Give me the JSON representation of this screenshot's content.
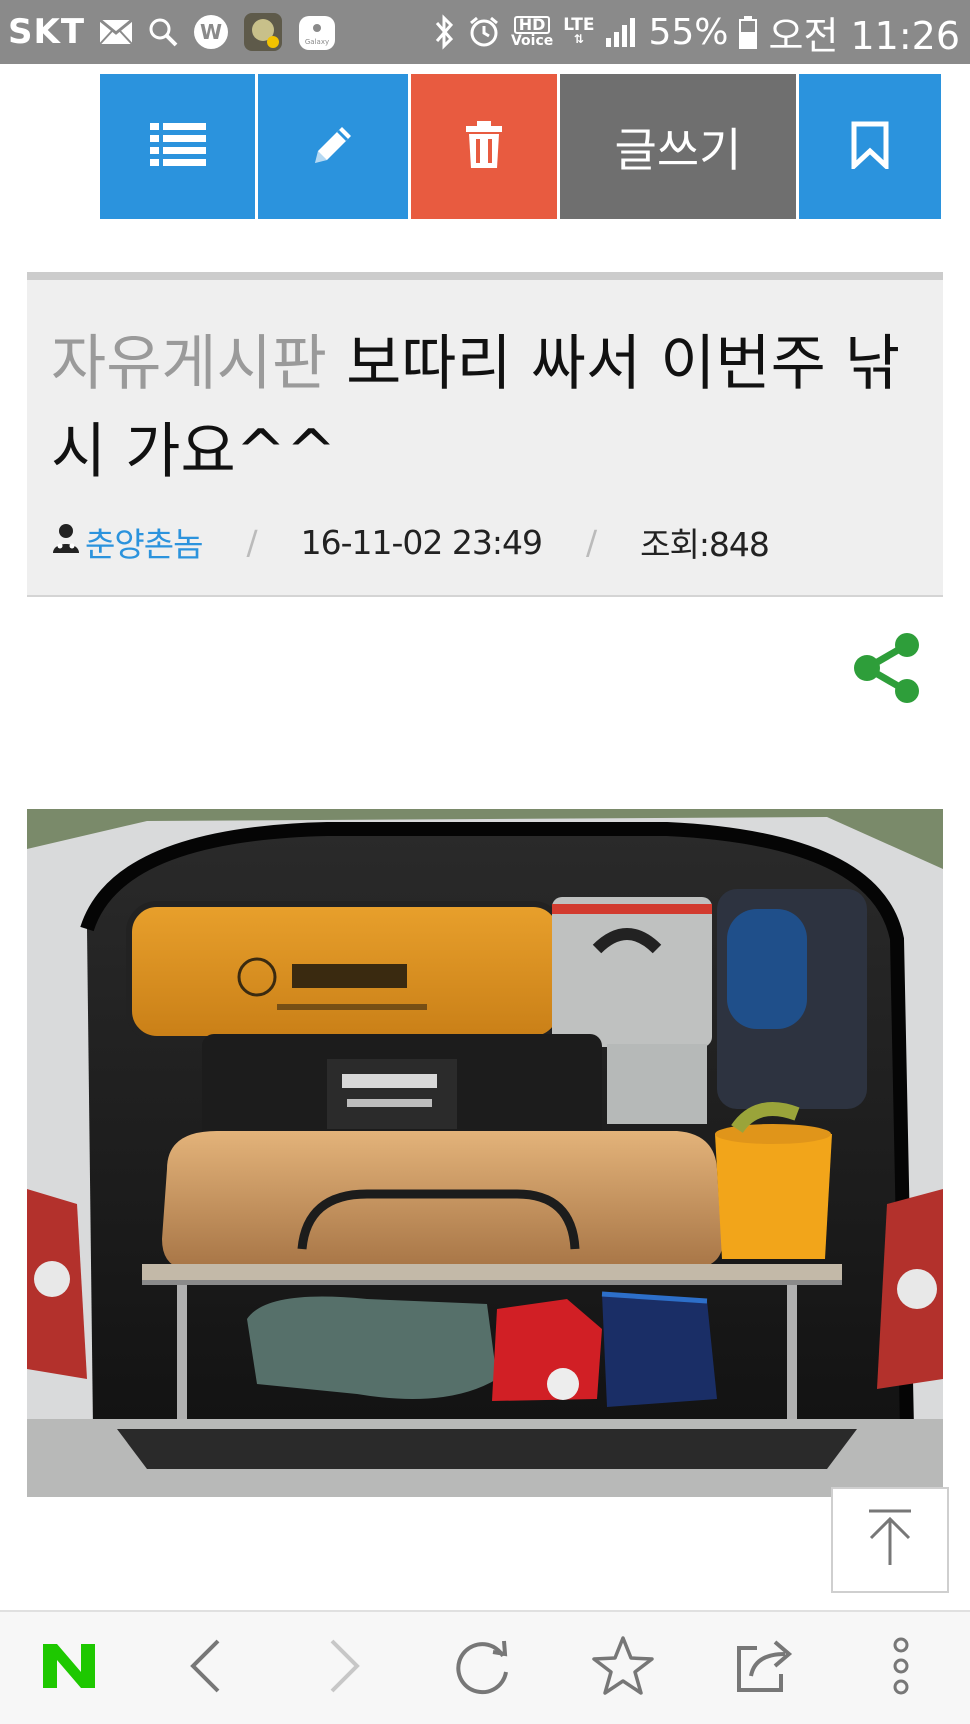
{
  "status_bar": {
    "carrier": "SKT",
    "hd_label": "HD",
    "voice_label": "Voice",
    "network": "LTE",
    "battery": "55%",
    "time": "오전 11:26",
    "icons": [
      "mail-icon",
      "search-icon",
      "w-icon",
      "moon-app-icon",
      "galaxy-icon",
      "bluetooth-icon",
      "alarm-icon",
      "signal-icon",
      "battery-icon"
    ]
  },
  "toolbar": {
    "write_label": "글쓰기",
    "icons": [
      "list-icon",
      "pencil-icon",
      "trash-icon",
      "bookmark-icon"
    ],
    "colors": {
      "blue": "#2b93dd",
      "red": "#e85b40",
      "gray": "#6f6f6f"
    }
  },
  "post": {
    "board": "자유게시판",
    "title": "보따리 싸서 이번주 낚시 가요^^",
    "author": "춘양촌놈",
    "date": "16-11-02 23:49",
    "views": "조회:848"
  },
  "share": {
    "icon": "share-icon",
    "color": "#2e9e3a"
  },
  "bottom_nav": {
    "icons": [
      "naver-n-icon",
      "back-icon",
      "forward-icon",
      "refresh-icon",
      "star-icon",
      "share-out-icon",
      "more-icon"
    ],
    "brand_color": "#1ec800"
  }
}
